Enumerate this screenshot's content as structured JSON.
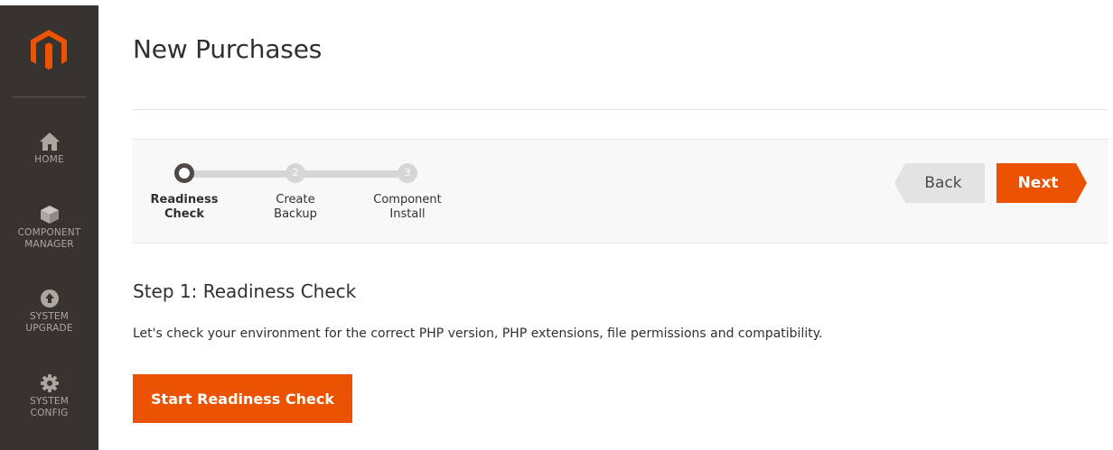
{
  "sidebar": {
    "logo": "magento-logo-icon",
    "items": [
      {
        "icon": "home-icon",
        "label_line1": "HOME",
        "label_line2": ""
      },
      {
        "icon": "component-cube-icon",
        "label_line1": "COMPONENT",
        "label_line2": "MANAGER"
      },
      {
        "icon": "upgrade-arrow-icon",
        "label_line1": "SYSTEM",
        "label_line2": "UPGRADE"
      },
      {
        "icon": "gear-icon",
        "label_line1": "SYSTEM",
        "label_line2": "CONFIG"
      }
    ]
  },
  "page": {
    "title": "New Purchases"
  },
  "wizard": {
    "steps": [
      {
        "number": "",
        "line1": "Readiness",
        "line2": "Check",
        "state": "active"
      },
      {
        "number": "2",
        "line1": "Create",
        "line2": "Backup",
        "state": "pending"
      },
      {
        "number": "3",
        "line1": "Component",
        "line2": "Install",
        "state": "pending"
      }
    ],
    "back_label": "Back",
    "next_label": "Next"
  },
  "content": {
    "heading": "Step 1: Readiness Check",
    "description": "Let's check your environment for the correct PHP version, PHP extensions, file permissions and compatibility.",
    "start_button_label": "Start Readiness Check"
  },
  "colors": {
    "sidebar_bg": "#373330",
    "accent": "#eb5202",
    "logo": "#eb5202",
    "back_button": "#e3e3e3"
  }
}
